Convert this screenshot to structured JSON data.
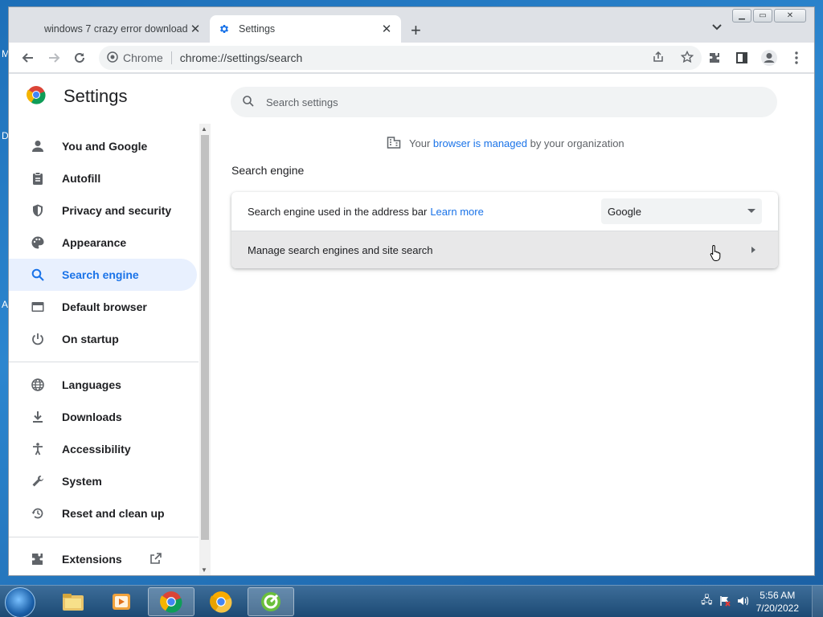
{
  "desktop": {
    "left_fragments": [
      "M",
      "D",
      "A"
    ]
  },
  "browser": {
    "tabs": [
      {
        "title": "windows 7 crazy error download",
        "close": "✕"
      },
      {
        "title": "Settings",
        "close": "✕"
      }
    ],
    "new_tab": "+",
    "omnibox": {
      "site": "Chrome",
      "url": "chrome://settings/search"
    }
  },
  "settings": {
    "title": "Settings",
    "search_placeholder": "Search settings",
    "managed": {
      "pre": "Your",
      "link": "browser is managed",
      "post": "by your organization"
    },
    "nav_primary": [
      {
        "label": "You and Google",
        "icon": "person-icon"
      },
      {
        "label": "Autofill",
        "icon": "clipboard-icon"
      },
      {
        "label": "Privacy and security",
        "icon": "shield-icon"
      },
      {
        "label": "Appearance",
        "icon": "palette-icon"
      },
      {
        "label": "Search engine",
        "icon": "search-icon",
        "selected": true
      },
      {
        "label": "Default browser",
        "icon": "browser-icon"
      },
      {
        "label": "On startup",
        "icon": "power-icon"
      }
    ],
    "nav_secondary": [
      {
        "label": "Languages",
        "icon": "globe-icon"
      },
      {
        "label": "Downloads",
        "icon": "download-icon"
      },
      {
        "label": "Accessibility",
        "icon": "accessibility-icon"
      },
      {
        "label": "System",
        "icon": "wrench-icon"
      },
      {
        "label": "Reset and clean up",
        "icon": "history-icon"
      }
    ],
    "nav_extensions": {
      "label": "Extensions",
      "icon": "puzzle-icon"
    },
    "section_title": "Search engine",
    "row1": {
      "label": "Search engine used in the address bar",
      "link": "Learn more",
      "selected_engine": "Google"
    },
    "row2": {
      "label": "Manage search engines and site search"
    }
  },
  "taskbar": {
    "apps": [
      "explorer-icon",
      "media-player-icon",
      "chrome-icon",
      "chrome-canary-icon",
      "app-icon"
    ],
    "clock_time": "5:56 AM",
    "clock_date": "7/20/2022"
  },
  "colors": {
    "accent": "#1a73e8",
    "selected_bg": "#e8f0fe",
    "hover_row": "#e8e8e9"
  }
}
